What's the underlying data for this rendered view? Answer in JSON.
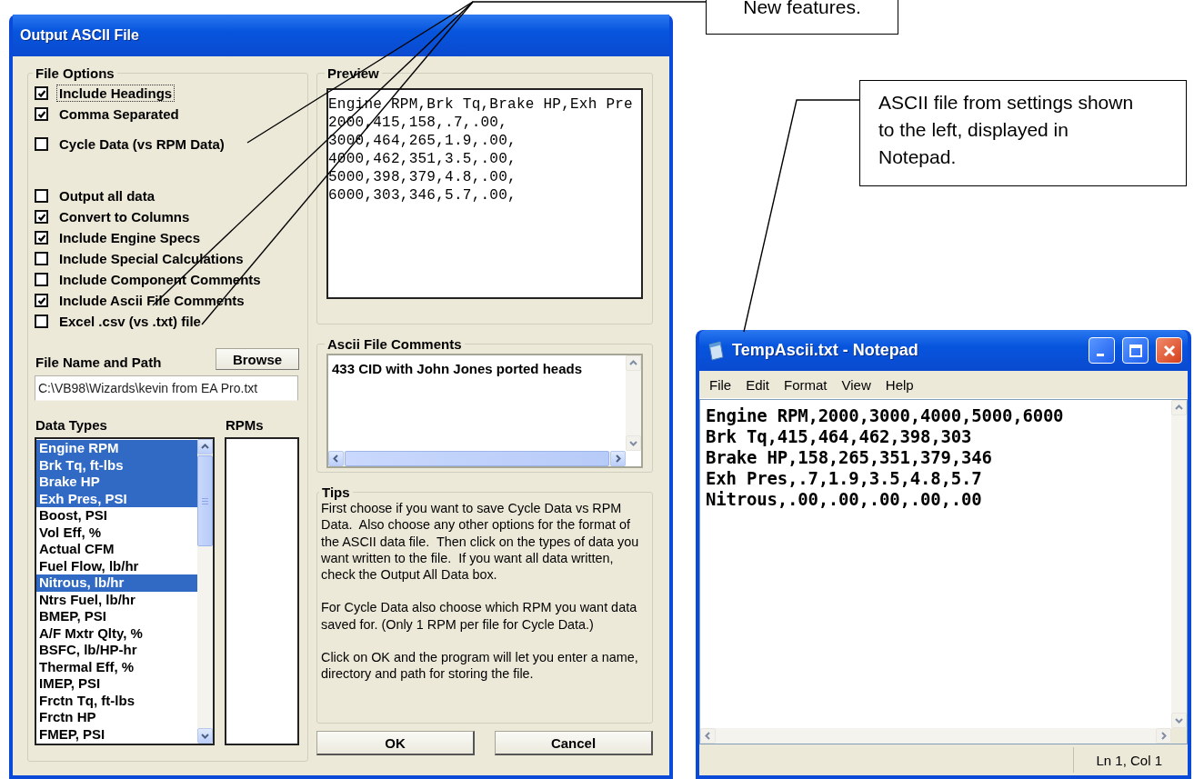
{
  "dialog": {
    "title": "Output ASCII File",
    "file_options": {
      "title": "File Options",
      "items": [
        {
          "label": "Include Headings",
          "checked": true,
          "focused": true
        },
        {
          "label": "Comma Separated",
          "checked": true,
          "focused": false
        },
        {
          "label": "Cycle Data (vs RPM Data)",
          "checked": false,
          "focused": false
        },
        {
          "label": "Output all data",
          "checked": false,
          "focused": false
        },
        {
          "label": "Convert to Columns",
          "checked": true,
          "focused": false
        },
        {
          "label": "Include Engine Specs",
          "checked": true,
          "focused": false
        },
        {
          "label": "Include Special Calculations",
          "checked": false,
          "focused": false
        },
        {
          "label": "Include Component Comments",
          "checked": false,
          "focused": false
        },
        {
          "label": "Include Ascii File Comments",
          "checked": true,
          "focused": false
        },
        {
          "label": "Excel .csv (vs .txt) file",
          "checked": false,
          "focused": false
        }
      ]
    },
    "file_name_label": "File Name and Path",
    "browse_button": "Browse",
    "path_value": "C:\\VB98\\Wizards\\kevin from EA Pro.txt",
    "data_types": {
      "label": "Data Types",
      "items": [
        {
          "label": "Engine RPM",
          "selected": true
        },
        {
          "label": "Brk Tq, ft-lbs",
          "selected": true
        },
        {
          "label": "Brake HP",
          "selected": true
        },
        {
          "label": "Exh Pres, PSI",
          "selected": true
        },
        {
          "label": "Boost, PSI",
          "selected": false
        },
        {
          "label": "Vol Eff, %",
          "selected": false
        },
        {
          "label": "Actual CFM",
          "selected": false
        },
        {
          "label": "Fuel Flow, lb/hr",
          "selected": false
        },
        {
          "label": "Nitrous, lb/hr",
          "selected": true
        },
        {
          "label": "Ntrs Fuel, lb/hr",
          "selected": false
        },
        {
          "label": "BMEP, PSI",
          "selected": false
        },
        {
          "label": "A/F Mxtr Qlty, %",
          "selected": false
        },
        {
          "label": "BSFC, lb/HP-hr",
          "selected": false
        },
        {
          "label": "Thermal Eff, %",
          "selected": false
        },
        {
          "label": "IMEP, PSI",
          "selected": false
        },
        {
          "label": "Frctn Tq, ft-lbs",
          "selected": false
        },
        {
          "label": "Frctn HP",
          "selected": false
        },
        {
          "label": "FMEP, PSI",
          "selected": false
        }
      ]
    },
    "rpms_label": "RPMs",
    "preview": {
      "title": "Preview",
      "lines": [
        "Engine RPM,Brk Tq,Brake HP,Exh Pre",
        "2000,415,158,.7,.00,",
        "3000,464,265,1.9,.00,",
        "4000,462,351,3.5,.00,",
        "5000,398,379,4.8,.00,",
        "6000,303,346,5.7,.00,"
      ]
    },
    "comments": {
      "title": "Ascii File Comments",
      "value": "433 CID with John Jones ported heads"
    },
    "tips": {
      "title": "Tips",
      "paragraphs": [
        "First choose if you want to save Cycle Data vs RPM Data.  Also choose any other options for the format of the ASCII data file.  Then click on the types of data you want written to the file.  If you want all data written, check the Output All Data box.",
        "For Cycle Data also choose which RPM you want data saved for. (Only 1 RPM per file for Cycle Data.)",
        "Click on OK and the program will let you enter a name, directory and path for storing the file."
      ]
    },
    "buttons": [
      "OK",
      "Cancel"
    ]
  },
  "notepad": {
    "title": "TempAscii.txt - Notepad",
    "menu": [
      "File",
      "Edit",
      "Format",
      "View",
      "Help"
    ],
    "lines": [
      "Engine RPM,2000,3000,4000,5000,6000",
      "Brk Tq,415,464,462,398,303",
      "Brake HP,158,265,351,379,346",
      "Exh Pres,.7,1.9,3.5,4.8,5.7",
      "Nitrous,.00,.00,.00,.00,.00"
    ],
    "status": "Ln 1, Col 1"
  },
  "callouts": [
    {
      "text": "New features."
    },
    {
      "text": "ASCII file from settings shown to the left, displayed in Notepad."
    }
  ]
}
